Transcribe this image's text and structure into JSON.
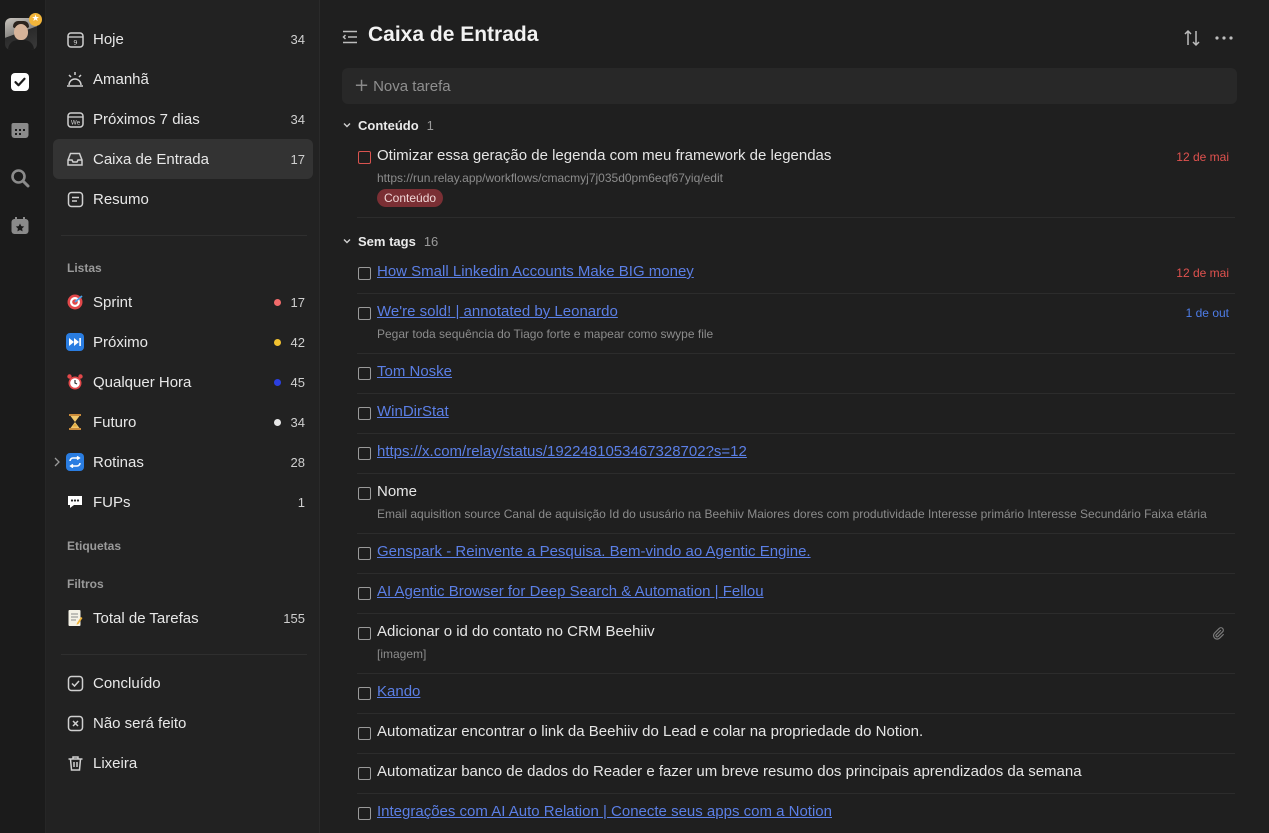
{
  "colors": {
    "accent_red": "#e0524f",
    "accent_blue": "#4e7de8",
    "link": "#5b7fe6",
    "tag_bg": "#7a2f34"
  },
  "rail": {
    "icons": [
      "avatar",
      "check-square-icon",
      "calendar-icon",
      "search-icon",
      "star-calendar-icon"
    ]
  },
  "sidebar": {
    "smart": [
      {
        "label": "Hoje",
        "count": "34",
        "icon": "calendar-day-icon"
      },
      {
        "label": "Amanhã",
        "count": "",
        "icon": "sunrise-icon"
      },
      {
        "label": "Próximos 7 dias",
        "count": "34",
        "icon": "calendar-week-icon"
      },
      {
        "label": "Caixa de Entrada",
        "count": "17",
        "icon": "inbox-icon"
      },
      {
        "label": "Resumo",
        "count": "",
        "icon": "summary-icon"
      }
    ],
    "lists_label": "Listas",
    "lists": [
      {
        "label": "Sprint",
        "count": "17",
        "dot": "#f26b6b"
      },
      {
        "label": "Próximo",
        "count": "42",
        "dot": "#f2c230"
      },
      {
        "label": "Qualquer Hora",
        "count": "45",
        "dot": "#2b3fe0"
      },
      {
        "label": "Futuro",
        "count": "34",
        "dot": "#e6e6e6"
      },
      {
        "label": "Rotinas",
        "count": "28",
        "dot": ""
      },
      {
        "label": "FUPs",
        "count": "1",
        "dot": ""
      }
    ],
    "tags_label": "Etiquetas",
    "filters_label": "Filtros",
    "filters": [
      {
        "label": "Total de Tarefas",
        "count": "155"
      }
    ],
    "bottom": [
      {
        "label": "Concluído"
      },
      {
        "label": "Não será feito"
      },
      {
        "label": "Lixeira"
      }
    ]
  },
  "main": {
    "title": "Caixa de Entrada",
    "new_task_placeholder": "Nova tarefa",
    "groups": [
      {
        "name": "Conteúdo",
        "count": "1"
      },
      {
        "name": "Sem tags",
        "count": "16"
      }
    ],
    "tasks": [
      {
        "title": "Otimizar essa geração de legenda com meu framework de legendas",
        "sub": "https://run.relay.app/workflows/cmacmyj7j035d0pm6eqf67yiq/edit",
        "tag": "Conteúdo",
        "date": "12 de mai"
      },
      {
        "title": "How Small Linkedin Accounts Make BIG money",
        "date": "12 de mai"
      },
      {
        "title": "We're sold! | annotated by Leonardo",
        "sub": "Pegar toda sequência do Tiago forte e mapear como swype file",
        "date": "1 de out"
      },
      {
        "title": "Tom Noske"
      },
      {
        "title": "WinDirStat"
      },
      {
        "title": "https://x.com/relay/status/1922481053467328702?s=12"
      },
      {
        "title": "Nome",
        "sub": "Email aquisition source Canal de aquisição Id do ususário na Beehiiv Maiores dores com produtividade Interesse primário Interesse Secundário Faixa etária"
      },
      {
        "title": "Genspark - Reinvente a Pesquisa. Bem-vindo ao Agentic Engine."
      },
      {
        "title": "AI Agentic Browser for Deep Search & Automation | Fellou"
      },
      {
        "title": "Adicionar o id do contato no CRM Beehiiv",
        "sub": "[imagem]"
      },
      {
        "title": "Kando"
      },
      {
        "title": "Automatizar encontrar o link da Beehiiv do Lead e colar na propriedade do Notion."
      },
      {
        "title": "Automatizar banco de dados do Reader e fazer um breve resumo dos principais aprendizados da semana"
      },
      {
        "title": "Integrações com AI Auto Relation | Conecte seus apps com a Notion"
      }
    ]
  }
}
